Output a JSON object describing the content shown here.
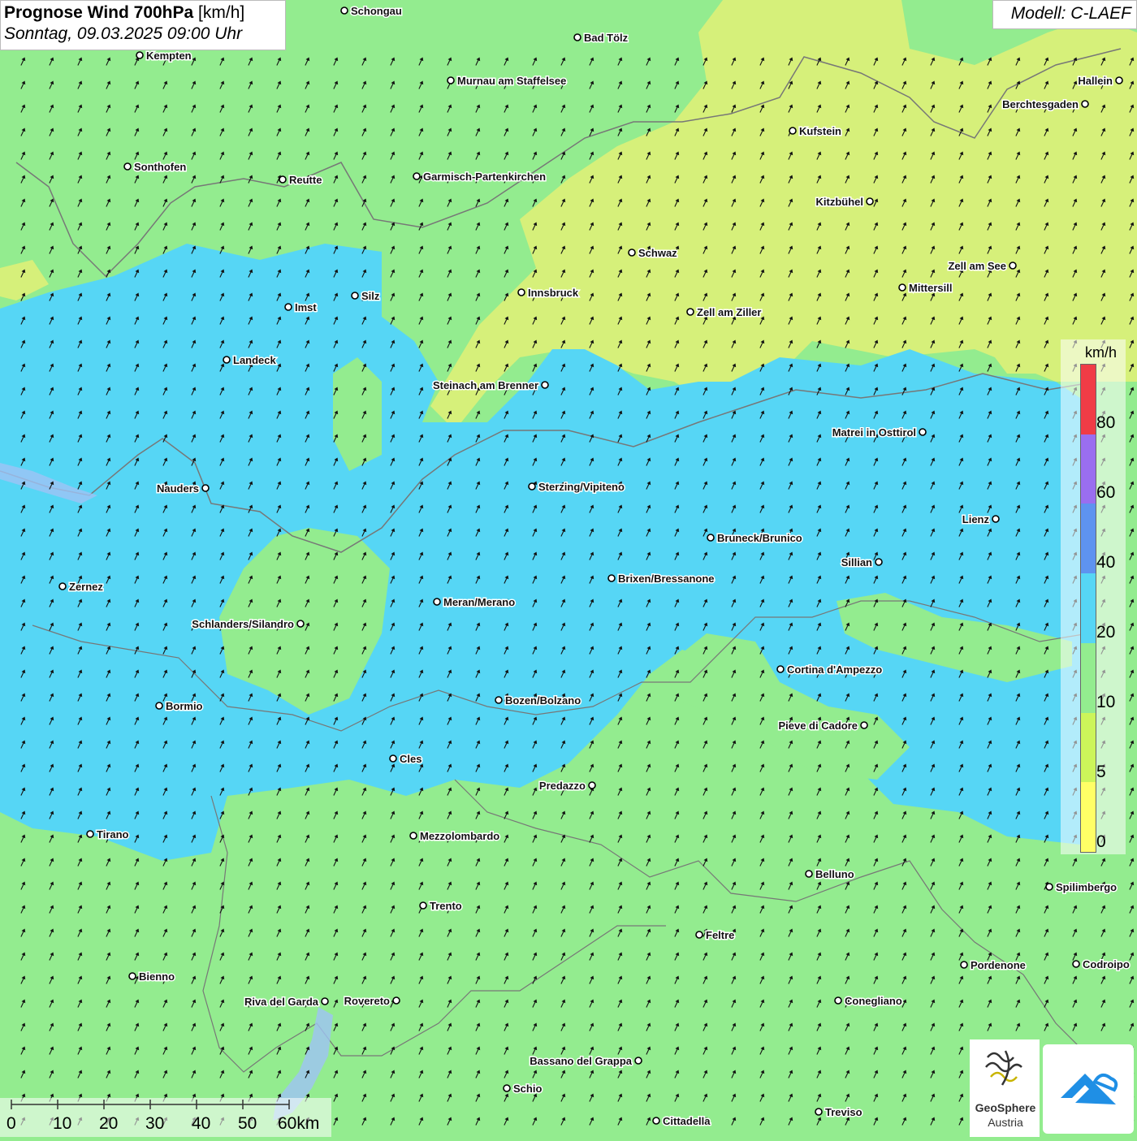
{
  "header": {
    "title_bold": "Prognose Wind 700hPa",
    "title_unit": " [km/h]",
    "subtitle": "Sonntag, 09.03.2025 09:00 Uhr"
  },
  "model": {
    "label": "Modell: C-LAEF"
  },
  "legend": {
    "unit": "km/h",
    "ticks": [
      "0",
      "5",
      "10",
      "20",
      "40",
      "60",
      "80"
    ],
    "colors": [
      "#ffff66",
      "#ccf55a",
      "#93ec8f",
      "#56d6f5",
      "#5e93f0",
      "#9a6ef0",
      "#f03c46"
    ]
  },
  "colors": {
    "calm": "#93ec8f",
    "moderate": "#56d6f5",
    "light": "#d6f07a"
  },
  "wind_direction": "south-west",
  "scale_bar": {
    "labels": [
      "0",
      "10",
      "20",
      "30",
      "40",
      "50",
      "60km"
    ]
  },
  "cities": [
    {
      "name": "Schongau"
    },
    {
      "name": "Bad Tölz"
    },
    {
      "name": "Kempten"
    },
    {
      "name": "Murnau am Staffelsee"
    },
    {
      "name": "Hallein"
    },
    {
      "name": "Berchtesgaden"
    },
    {
      "name": "Kufstein"
    },
    {
      "name": "Sonthofen"
    },
    {
      "name": "Reutte"
    },
    {
      "name": "Garmisch-Partenkirchen"
    },
    {
      "name": "Kitzbühel"
    },
    {
      "name": "Schwaz"
    },
    {
      "name": "Zell am See"
    },
    {
      "name": "Mittersill"
    },
    {
      "name": "Silz"
    },
    {
      "name": "Innsbruck"
    },
    {
      "name": "Imst"
    },
    {
      "name": "Zell am Ziller"
    },
    {
      "name": "Landeck"
    },
    {
      "name": "Steinach am Brenner"
    },
    {
      "name": "Matrei in Osttirol"
    },
    {
      "name": "Nauders"
    },
    {
      "name": "Sterzing/Vipiteno"
    },
    {
      "name": "Lienz"
    },
    {
      "name": "Bruneck/Brunico"
    },
    {
      "name": "Sillian"
    },
    {
      "name": "Zernez"
    },
    {
      "name": "Brixen/Bressanone"
    },
    {
      "name": "Meran/Merano"
    },
    {
      "name": "Schlanders/Silandro"
    },
    {
      "name": "Cortina d'Ampezzo"
    },
    {
      "name": "Bozen/Bolzano"
    },
    {
      "name": "Bormio"
    },
    {
      "name": "Pieve di Cadore"
    },
    {
      "name": "Cles"
    },
    {
      "name": "Predazzo"
    },
    {
      "name": "Tirano"
    },
    {
      "name": "Mezzolombardo"
    },
    {
      "name": "Belluno"
    },
    {
      "name": "Spilimbergo"
    },
    {
      "name": "Trento"
    },
    {
      "name": "Feltre"
    },
    {
      "name": "Pordenone"
    },
    {
      "name": "Codroipo"
    },
    {
      "name": "Bienno"
    },
    {
      "name": "Riva del Garda"
    },
    {
      "name": "Rovereto"
    },
    {
      "name": "Conegliano"
    },
    {
      "name": "Bassano del Grappa"
    },
    {
      "name": "Schio"
    },
    {
      "name": "Treviso"
    },
    {
      "name": "Cittadella"
    }
  ],
  "logos": {
    "geosphere_line1": "GeoSphere",
    "geosphere_line2": "Austria"
  }
}
